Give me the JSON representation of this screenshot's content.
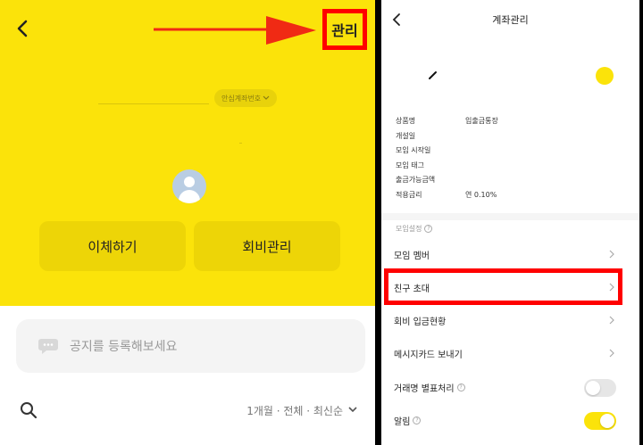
{
  "left": {
    "manage_label": "관리",
    "account_chip": "안심계좌번호",
    "transfer_button": "이체하기",
    "fee_button": "회비관리",
    "notice_placeholder": "공지를 등록해보세요",
    "filter_label": "1개월 · 전체 · 최신순"
  },
  "right": {
    "title": "계좌관리",
    "info": [
      {
        "label": "상품명",
        "value": "입출금통장"
      },
      {
        "label": "개설일",
        "value": ""
      },
      {
        "label": "모임 시작일",
        "value": ""
      },
      {
        "label": "모임 태그",
        "value": ""
      },
      {
        "label": "출금가능금액",
        "value": ""
      },
      {
        "label": "적용금리",
        "value": "연 0.10%"
      }
    ],
    "section_label": "모임설정",
    "menu": {
      "members": "모임 멤버",
      "invite": "친구 초대",
      "deposit_status": "회비 입금현황",
      "message_card": "메시지카드 보내기",
      "masking": "거래명 별표처리",
      "alarm": "알림"
    },
    "toggles": {
      "masking": "off",
      "alarm": "on"
    }
  },
  "colors": {
    "accent": "#fbe30a",
    "highlight": "#ff0000"
  },
  "icons": [
    "back-chevron-icon",
    "red-arrow-icon",
    "avatar-icon",
    "speech-bubble-icon",
    "search-icon",
    "chevron-down-icon",
    "pencil-icon",
    "question-icon",
    "chevron-right-icon"
  ]
}
